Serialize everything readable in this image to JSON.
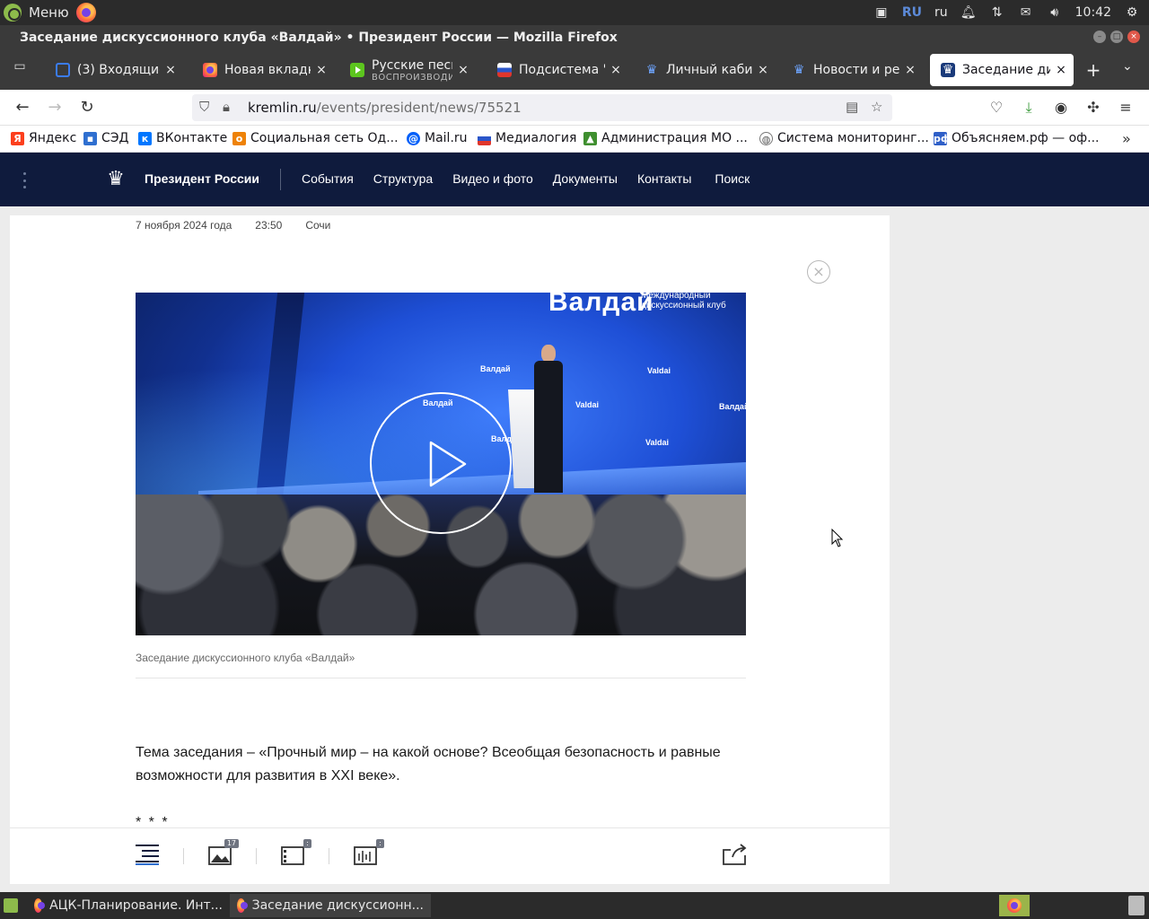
{
  "os_panel": {
    "menu_label": "Меню",
    "keyboard_layout": "RU",
    "language": "ru",
    "clock": "10:42"
  },
  "window": {
    "title": "Заседание дискуссионного клуба «Валдай» • Президент России — Mozilla Firefox"
  },
  "tabs": [
    {
      "label": "(3) Входящие - ",
      "icon": "mail-icon"
    },
    {
      "label": "Новая вкладка",
      "icon": "firefox-icon"
    },
    {
      "label": "Русские песни",
      "sublabel": "ВОСПРОИЗВОДИТСЯ",
      "icon": "play-icon"
    },
    {
      "label": "Подсистема \"П",
      "icon": "flag-icon"
    },
    {
      "label": "Личный кабин",
      "icon": "eagle-icon"
    },
    {
      "label": "Новости и реп",
      "icon": "eagle-icon"
    },
    {
      "label": "Заседание дис",
      "icon": "eagle-icon",
      "active": true
    }
  ],
  "address_bar": {
    "host": "kremlin.ru",
    "path": "/events/president/news/75521"
  },
  "bookmarks": [
    {
      "label": "Яндекс",
      "icon": "yandex-icon",
      "color": "#fc3f1d"
    },
    {
      "label": "СЭД",
      "icon": "briefcase-icon",
      "color": "#2f6fd0"
    },
    {
      "label": "ВКонтакте",
      "icon": "vk-icon",
      "color": "#0077ff"
    },
    {
      "label": "Социальная сеть Од...",
      "icon": "ok-icon",
      "color": "#ee8208"
    },
    {
      "label": "Mail.ru",
      "icon": "mailru-icon",
      "color": "#005ff9"
    },
    {
      "label": "Медиалогия",
      "icon": "flag-icon",
      "color": "#2b56c9"
    },
    {
      "label": "Администрация МО ...",
      "icon": "coat-of-arms-icon",
      "color": "#3f8f2f"
    },
    {
      "label": "Система мониторинг...",
      "icon": "globe-icon",
      "color": "#555555"
    },
    {
      "label": "Объясняем.рф — оф...",
      "icon": "explain-rf-icon",
      "color": "#2f5fc8"
    }
  ],
  "site": {
    "brand": "Президент России",
    "nav": [
      "События",
      "Структура",
      "Видео и фото",
      "Документы",
      "Контакты",
      "Поиск"
    ],
    "header_color": "#0f1b3d"
  },
  "article": {
    "date": "7 ноября 2024 года",
    "time": "23:50",
    "place": "Сочи",
    "video_logo": "Валдай",
    "video_logo_sub": "Международный дискуссионный клуб",
    "video_badge_ru": "Валдай",
    "video_badge_en": "Valdai",
    "caption": "Заседание дискуссионного клуба «Валдай»",
    "topic": "Тема заседания – «Прочный мир – на какой основе? Всеобщая безопасность и равные возможности для развития в XXI веке».",
    "separator": "* * *"
  },
  "bottom_toolbar": {
    "photos_count": "17"
  },
  "taskbar": {
    "items": [
      {
        "label": "АЦК-Планирование. Инт...",
        "icon": "firefox-icon"
      },
      {
        "label": "Заседание дискуссионн...",
        "icon": "firefox-icon",
        "active": true
      }
    ]
  }
}
